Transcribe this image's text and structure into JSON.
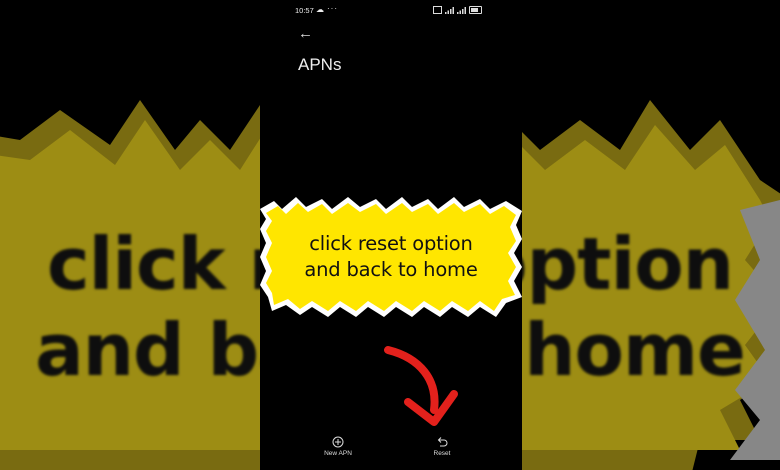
{
  "status_bar": {
    "time": "10:57",
    "more": "···"
  },
  "header": {
    "title": "APNs"
  },
  "overlay": {
    "line1": "click reset option",
    "line2": "and back to home",
    "sticker_color": "#FFE600",
    "arrow_color": "#E3211C"
  },
  "background": {
    "line1": "click reset option",
    "line2": "and back to home"
  },
  "bottom_bar": {
    "new_apn_label": "New APN",
    "reset_label": "Reset"
  }
}
